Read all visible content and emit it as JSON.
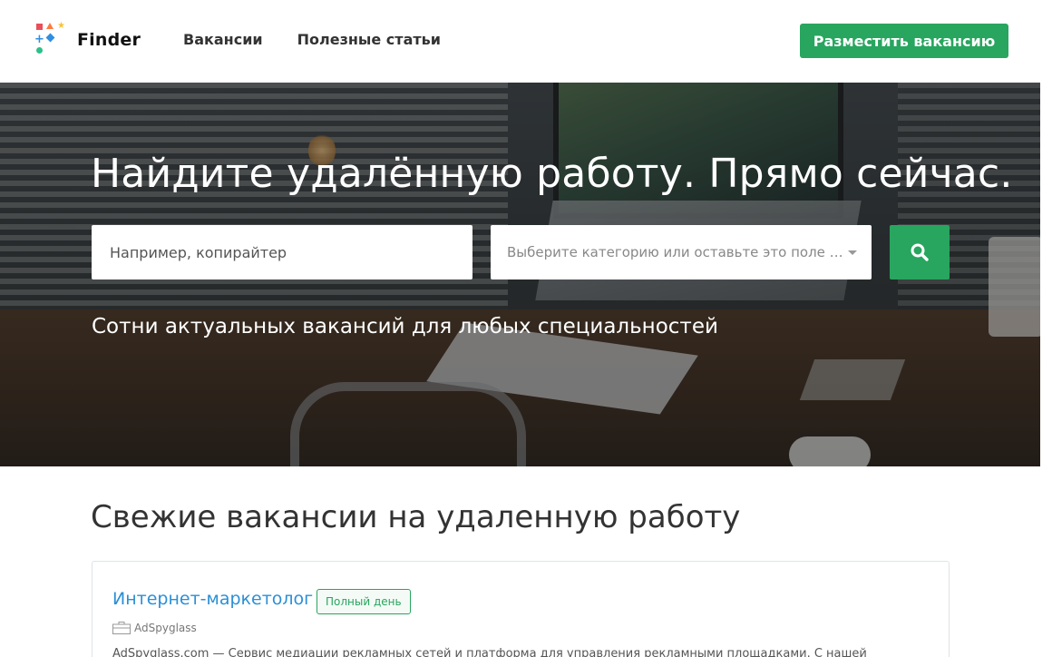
{
  "header": {
    "logo_text": "Finder",
    "nav": [
      "Вакансии",
      "Полезные статьи"
    ],
    "cta_label": "Разместить вакансию"
  },
  "hero": {
    "title": "Найдите удалённую работу. Прямо сейчас.",
    "search_placeholder": "Например, копирайтер",
    "category_placeholder": "Выберите категорию или оставьте это поле пустым",
    "subtitle": "Сотни актуальных вакансий для любых специальностей"
  },
  "main": {
    "section_title": "Свежие вакансии на удаленную работу",
    "jobs": [
      {
        "title": "Интернет-маркетолог",
        "badge": "Полный день",
        "company": "AdSpyglass",
        "description": "AdSpyglass.com — Сервис медиации рекламных сетей и платформа для управления рекламными площадками. С нашей"
      }
    ]
  },
  "colors": {
    "accent": "#28a55f",
    "link": "#2b8fd6"
  },
  "icons": {
    "search": "search-icon",
    "briefcase": "briefcase-icon",
    "caret": "chevron-down-icon"
  }
}
